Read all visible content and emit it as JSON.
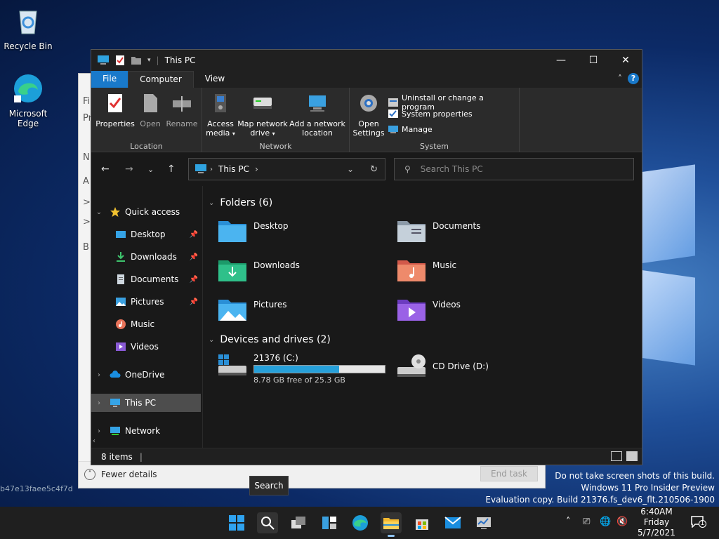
{
  "desktop": {
    "recycle_bin": "Recycle Bin",
    "edge_line1": "Microsoft",
    "edge_line2": "Edge",
    "hash_text": "b47e13faee5c4f7d"
  },
  "taskmgr": {
    "left_labels": [
      "Fi",
      "Pr",
      "N",
      "A",
      ">",
      ">",
      "B"
    ],
    "fewer_details": "Fewer details",
    "end_task": "End task"
  },
  "explorer": {
    "title": "This PC",
    "tabs": {
      "file": "File",
      "computer": "Computer",
      "view": "View"
    },
    "ribbon": {
      "location": {
        "label": "Location",
        "properties": "Properties",
        "open": "Open",
        "rename": "Rename"
      },
      "network": {
        "label": "Network",
        "access_media_1": "Access",
        "access_media_2": "media",
        "map_drive_1": "Map network",
        "map_drive_2": "drive",
        "add_location_1": "Add a network",
        "add_location_2": "location"
      },
      "system": {
        "label": "System",
        "open_settings_1": "Open",
        "open_settings_2": "Settings",
        "uninstall": "Uninstall or change a program",
        "system_properties": "System properties",
        "manage": "Manage"
      }
    },
    "address": {
      "crumb": "This PC"
    },
    "search": {
      "placeholder": "Search This PC"
    },
    "nav": {
      "quick_access": "Quick access",
      "desktop": "Desktop",
      "downloads": "Downloads",
      "documents": "Documents",
      "pictures": "Pictures",
      "music": "Music",
      "videos": "Videos",
      "onedrive": "OneDrive",
      "this_pc": "This PC",
      "network": "Network"
    },
    "folders_header": "Folders (6)",
    "folders": {
      "desktop": "Desktop",
      "documents": "Documents",
      "downloads": "Downloads",
      "music": "Music",
      "pictures": "Pictures",
      "videos": "Videos"
    },
    "drives_header": "Devices and drives (2)",
    "drives": {
      "c_name": "21376 (C:)",
      "c_free": "8.78 GB free of 25.3 GB",
      "c_used_fraction": 0.653,
      "d_name": "CD Drive (D:)"
    },
    "status": {
      "items": "8 items"
    }
  },
  "tooltip": "Search",
  "watermark": {
    "line1": "Do not take screen shots of this build.",
    "line2": "Windows 11 Pro Insider Preview",
    "line3": "Evaluation copy. Build 21376.fs_dev6_flt.210506-1900"
  },
  "clock": {
    "time": "6:40AM",
    "day": "Friday",
    "date": "5/7/2021"
  },
  "notifications": {
    "count": "1"
  },
  "colors": {
    "accent": "#1979ca",
    "drive_bar": "#26a0da"
  }
}
